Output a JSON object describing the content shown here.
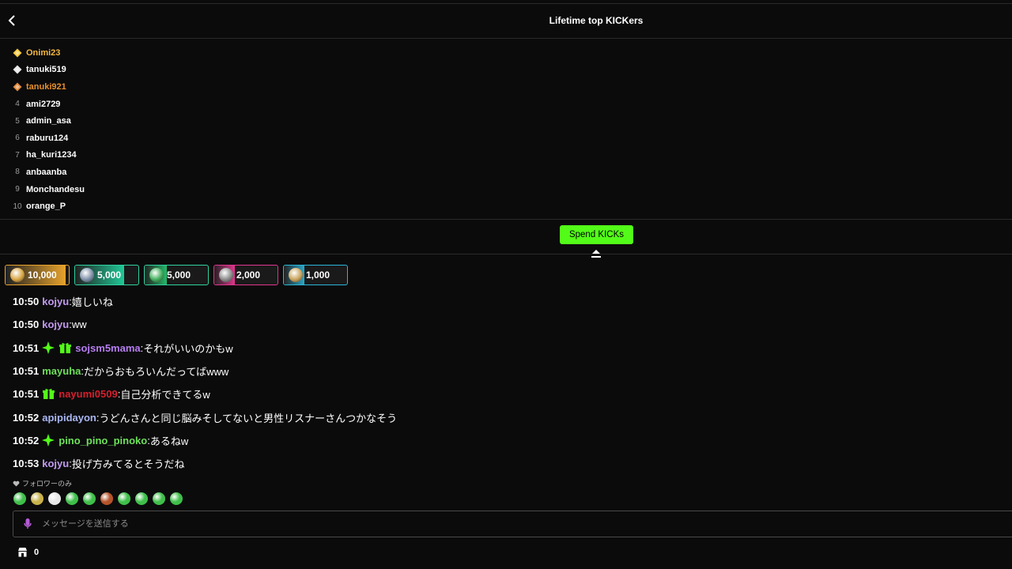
{
  "header": {
    "title": "Lifetime top KICKers",
    "back_icon": "chevron-left-icon"
  },
  "leaderboard": [
    {
      "rank": "1",
      "name": "Onimi23",
      "color": "#f5b940",
      "icon": "gold-diamond-icon"
    },
    {
      "rank": "2",
      "name": "tanuki519",
      "color": "#ffffff",
      "icon": "silver-diamond-icon"
    },
    {
      "rank": "3",
      "name": "tanuki921",
      "color": "#e8902c",
      "icon": "bronze-diamond-icon"
    },
    {
      "rank": "4",
      "name": "ami2729",
      "color": "#ffffff"
    },
    {
      "rank": "5",
      "name": "admin_asa",
      "color": "#ffffff"
    },
    {
      "rank": "6",
      "name": "raburu124",
      "color": "#ffffff"
    },
    {
      "rank": "7",
      "name": "ha_kuri1234",
      "color": "#ffffff"
    },
    {
      "rank": "8",
      "name": "anbaanba",
      "color": "#ffffff"
    },
    {
      "rank": "9",
      "name": "Monchandesu",
      "color": "#ffffff"
    },
    {
      "rank": "10",
      "name": "orange_P",
      "color": "#ffffff"
    }
  ],
  "spend_button": "Spend KICKs",
  "kick_chips": [
    {
      "amount": "10,000",
      "color": "#e8a32c",
      "border": "#e8a32c",
      "progress": 0.95
    },
    {
      "amount": "5,000",
      "color": "#20c997",
      "border": "#2ed3a0",
      "progress": 0.78
    },
    {
      "amount": "5,000",
      "color": "#25b96a",
      "border": "#2ed3a0",
      "progress": 0.35
    },
    {
      "amount": "2,000",
      "color": "#e0368e",
      "border": "#e0368e",
      "progress": 0.32
    },
    {
      "amount": "1,000",
      "color": "#2aa8c9",
      "border": "#2ab8d8",
      "progress": 0.32
    }
  ],
  "chat": [
    {
      "time": "10:50",
      "badges": [],
      "user": "kojyu",
      "user_color": "#c39bf0",
      "text": "嬉しいね"
    },
    {
      "time": "10:50",
      "badges": [],
      "user": "kojyu",
      "user_color": "#c39bf0",
      "text": "ww"
    },
    {
      "time": "10:51",
      "badges": [
        "sparkle-badge-icon",
        "gift-badge-icon"
      ],
      "user": "sojsm5mama",
      "user_color": "#b67ef0",
      "text": "それがいいのかもw"
    },
    {
      "time": "10:51",
      "badges": [],
      "user": "mayuha",
      "user_color": "#6ee05a",
      "text": "だからおもろいんだってばwww"
    },
    {
      "time": "10:51",
      "badges": [
        "gift-badge-icon"
      ],
      "user": "nayumi0509",
      "user_color": "#d4202e",
      "text": "自己分析できてるw"
    },
    {
      "time": "10:52",
      "badges": [],
      "user": "apipidayon",
      "user_color": "#a9b7f2",
      "text": "うどんさんと同じ脳みそしてないと男性リスナーさんつかなそう"
    },
    {
      "time": "10:52",
      "badges": [
        "sparkle-badge-icon"
      ],
      "user": "pino_pino_pinoko",
      "user_color": "#6ee05a",
      "text": "あるねw"
    },
    {
      "time": "10:53",
      "badges": [],
      "user": "kojyu",
      "user_color": "#c39bf0",
      "text": "投げ方みてるとそうだね"
    }
  ],
  "followers_only": "フォロワーのみ",
  "emotes": [
    "emote-1",
    "emote-2",
    "emote-3",
    "emote-4",
    "emote-5",
    "emote-6",
    "emote-7",
    "emote-8",
    "emote-9",
    "emote-10"
  ],
  "input": {
    "placeholder": "メッセージを送信する"
  },
  "bottom": {
    "count": "0",
    "icon": "store-icon"
  },
  "colors": {
    "accent": "#53fc18",
    "background": "#0b0b0c"
  }
}
